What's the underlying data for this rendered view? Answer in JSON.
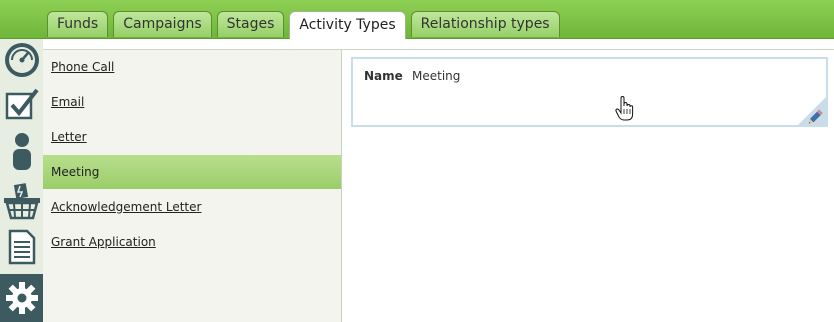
{
  "tabs": [
    {
      "label": "Funds"
    },
    {
      "label": "Campaigns"
    },
    {
      "label": "Stages"
    },
    {
      "label": "Activity Types"
    },
    {
      "label": "Relationship types"
    }
  ],
  "active_tab": "Activity Types",
  "sidebar_icons": [
    "dashboard-icon",
    "checklist-icon",
    "person-icon",
    "basket-icon",
    "document-icon",
    "gear-icon"
  ],
  "list": {
    "items": [
      {
        "label": "Phone Call"
      },
      {
        "label": "Email"
      },
      {
        "label": "Letter"
      },
      {
        "label": "Meeting"
      },
      {
        "label": "Acknowledgement Letter"
      },
      {
        "label": "Grant Application"
      }
    ],
    "selected": "Meeting"
  },
  "detail": {
    "name_label": "Name",
    "name_value": "Meeting"
  },
  "colors": {
    "topbar": "#7cc246",
    "active_item": "#a7d479",
    "active_sidebar": "#3c5a60",
    "card_border": "#c9dce9"
  }
}
